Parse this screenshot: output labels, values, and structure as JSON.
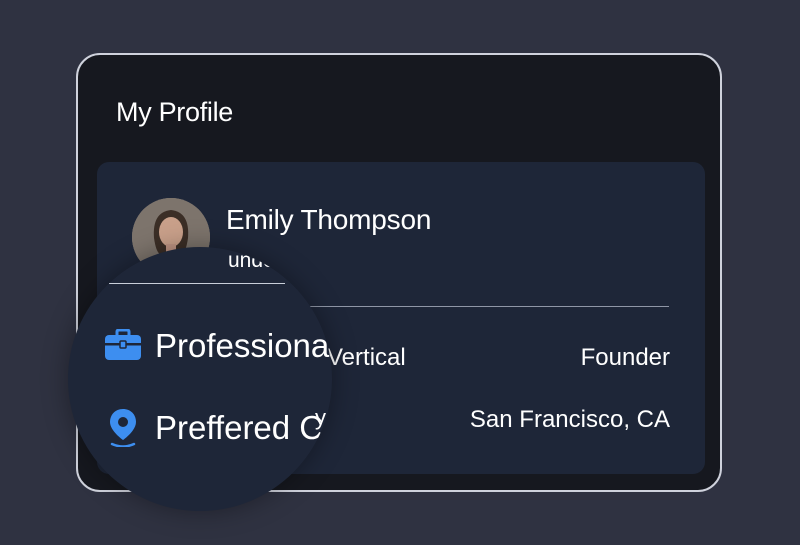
{
  "profile": {
    "title": "My Profile",
    "name": "Emily Thompson",
    "subtitle": "Founder",
    "subtitle_partial": "under",
    "rows": [
      {
        "label": "Vertical",
        "value": "Founder",
        "lens_label": "Professiona",
        "icon": "briefcase-icon"
      },
      {
        "label": "",
        "value": "San Francisco, CA",
        "lens_label": "Preffered C",
        "lens_tail": "y",
        "icon": "location-pin-icon"
      }
    ]
  },
  "colors": {
    "background": "#2f3241",
    "card": "#16181f",
    "panel": "#1e2638",
    "accent": "#3d8ef0"
  }
}
